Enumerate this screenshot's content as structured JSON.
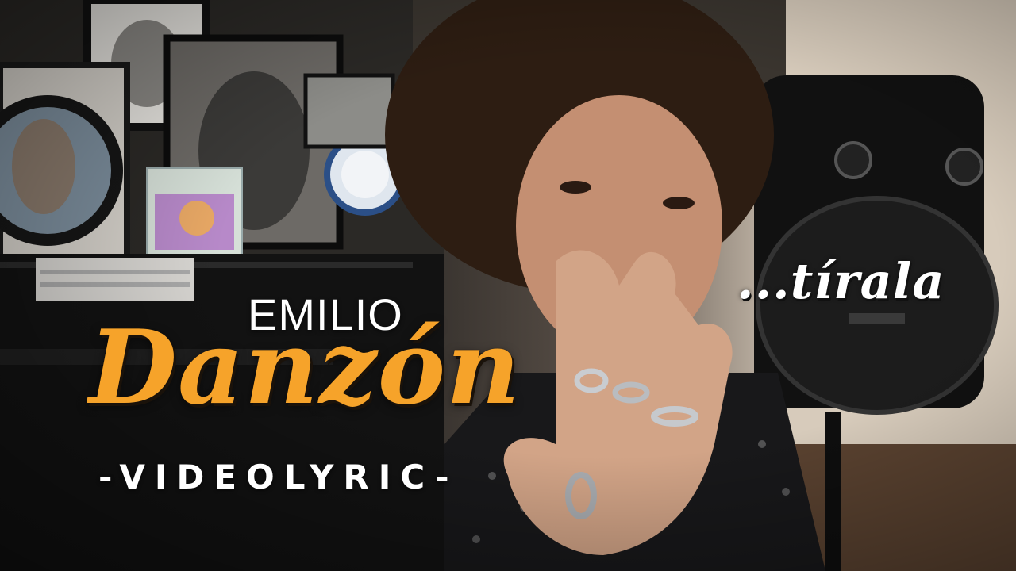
{
  "video": {
    "artist": "EMILIO",
    "song_title": "Danzón",
    "format_label": "-VIDEOLYRIC-",
    "lyric_snippet": "...tírala"
  },
  "colors": {
    "title_accent": "#f6a32a",
    "title_outline": "#1a120a",
    "text_white": "#ffffff"
  }
}
